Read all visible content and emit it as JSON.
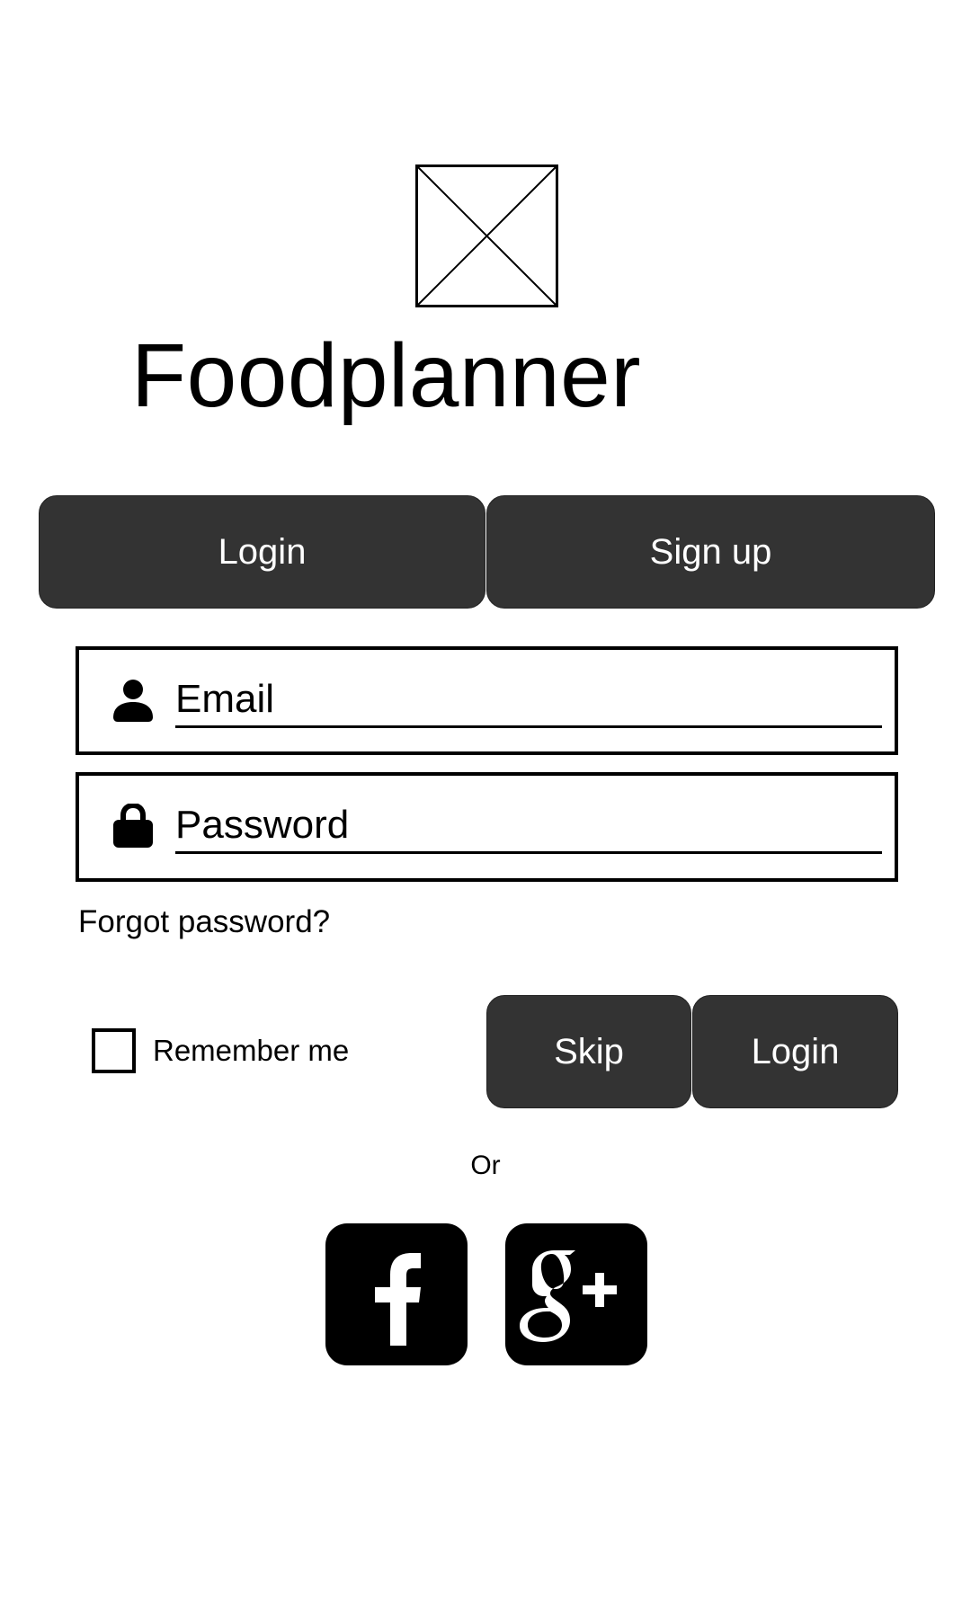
{
  "app": {
    "title": "Foodplanner"
  },
  "tabs": {
    "login_label": "Login",
    "signup_label": "Sign up"
  },
  "form": {
    "email_placeholder": "Email",
    "password_placeholder": "Password",
    "forgot_password_label": "Forgot password?",
    "remember_me_label": "Remember me",
    "remember_me_checked": false
  },
  "actions": {
    "skip_label": "Skip",
    "login_label": "Login"
  },
  "divider": {
    "or_label": "Or"
  },
  "social": {
    "facebook_icon": "facebook-icon",
    "google_plus_icon": "google-plus-icon"
  },
  "colors": {
    "button_bg": "#333333",
    "button_text": "#ffffff",
    "social_bg": "#000000"
  }
}
